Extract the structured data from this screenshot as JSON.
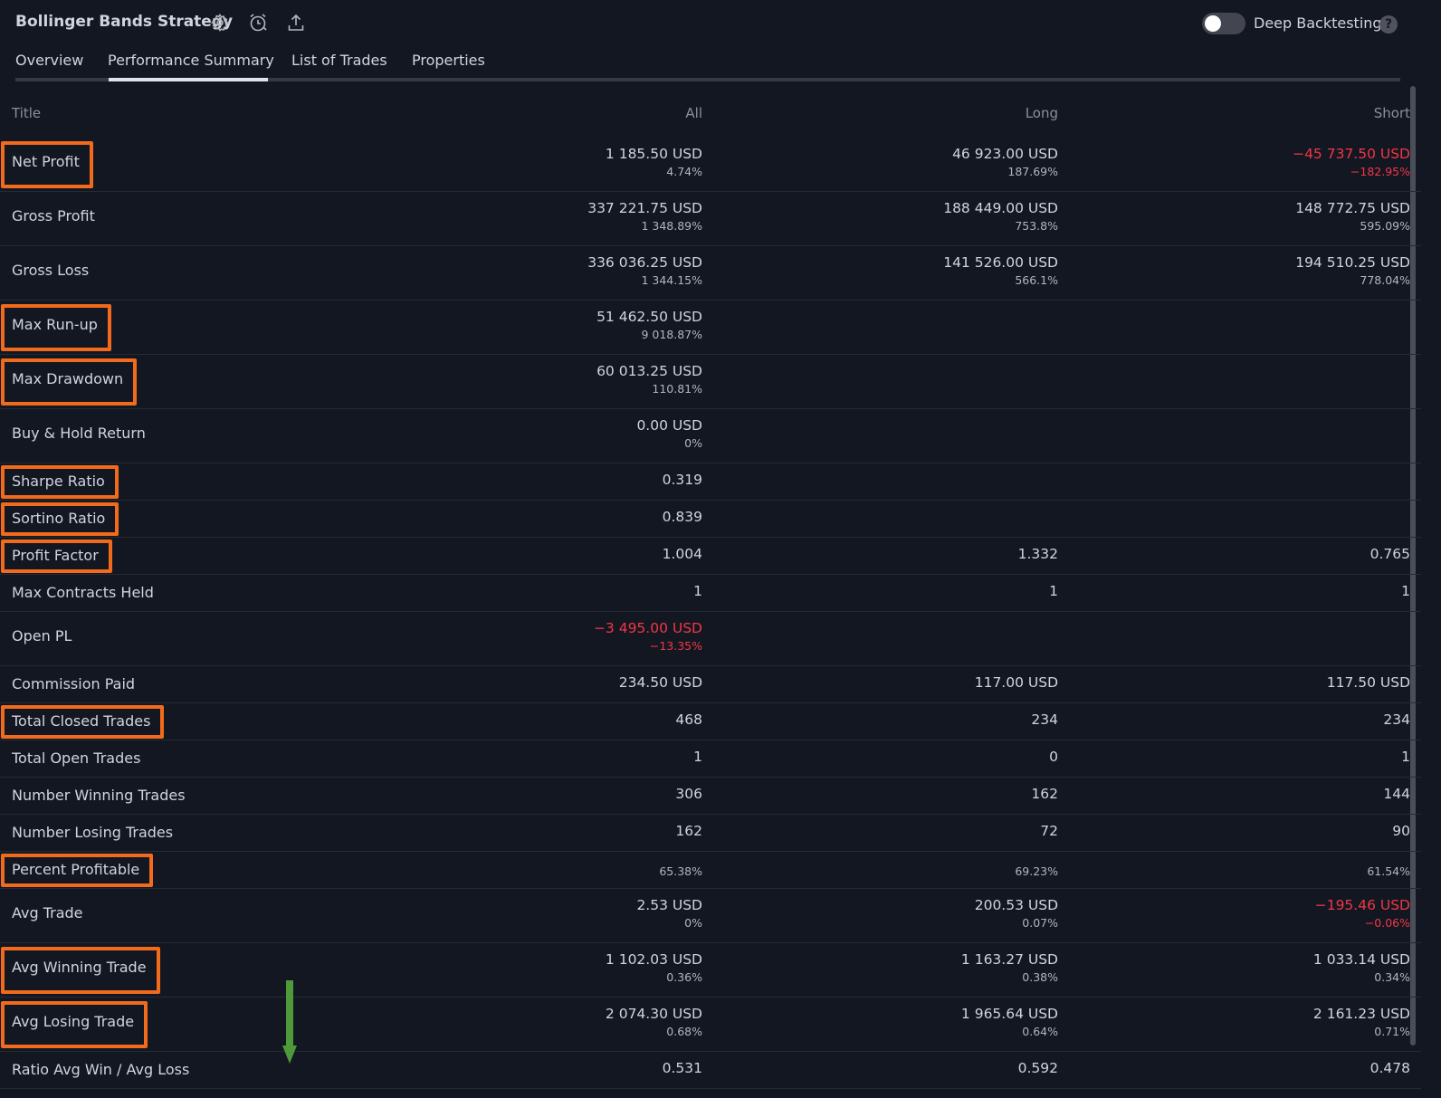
{
  "header": {
    "strategy_title": "Bollinger Bands Strategy",
    "icons": [
      "settings-icon",
      "alert-clock-icon",
      "export-icon"
    ],
    "deep_backtesting_label": "Deep Backtesting",
    "deep_backtesting_enabled": false,
    "help_glyph": "?"
  },
  "tabs": [
    {
      "label": "Overview"
    },
    {
      "label": "Performance Summary",
      "active": true
    },
    {
      "label": "List of Trades"
    },
    {
      "label": "Properties"
    }
  ],
  "table": {
    "columns": {
      "title": "Title",
      "all": "All",
      "long": "Long",
      "short": "Short"
    },
    "rows": [
      {
        "title": "Net Profit",
        "highlighted": true,
        "all": {
          "value": "1 185.50 USD",
          "pct": "4.74%"
        },
        "long": {
          "value": "46 923.00 USD",
          "pct": "187.69%"
        },
        "short": {
          "value": "−45 737.50 USD",
          "pct": "−182.95%",
          "negative": true
        }
      },
      {
        "title": "Gross Profit",
        "all": {
          "value": "337 221.75 USD",
          "pct": "1 348.89%"
        },
        "long": {
          "value": "188 449.00 USD",
          "pct": "753.8%"
        },
        "short": {
          "value": "148 772.75 USD",
          "pct": "595.09%"
        }
      },
      {
        "title": "Gross Loss",
        "all": {
          "value": "336 036.25 USD",
          "pct": "1 344.15%"
        },
        "long": {
          "value": "141 526.00 USD",
          "pct": "566.1%"
        },
        "short": {
          "value": "194 510.25 USD",
          "pct": "778.04%"
        }
      },
      {
        "title": "Max Run-up",
        "highlighted": true,
        "all": {
          "value": "51 462.50 USD",
          "pct": "9 018.87%"
        }
      },
      {
        "title": "Max Drawdown",
        "highlighted": true,
        "all": {
          "value": "60 013.25 USD",
          "pct": "110.81%"
        }
      },
      {
        "title": "Buy & Hold Return",
        "all": {
          "value": "0.00 USD",
          "pct": "0%"
        }
      },
      {
        "title": "Sharpe Ratio",
        "highlighted": true,
        "single": true,
        "all": {
          "value": "0.319"
        }
      },
      {
        "title": "Sortino Ratio",
        "highlighted": true,
        "single": true,
        "all": {
          "value": "0.839"
        }
      },
      {
        "title": "Profit Factor",
        "highlighted": true,
        "single": true,
        "all": {
          "value": "1.004"
        },
        "long": {
          "value": "1.332"
        },
        "short": {
          "value": "0.765"
        }
      },
      {
        "title": "Max Contracts Held",
        "single": true,
        "all": {
          "value": "1"
        },
        "long": {
          "value": "1"
        },
        "short": {
          "value": "1"
        }
      },
      {
        "title": "Open PL",
        "all": {
          "value": "−3 495.00 USD",
          "pct": "−13.35%",
          "negative": true
        }
      },
      {
        "title": "Commission Paid",
        "single": true,
        "all": {
          "value": "234.50 USD"
        },
        "long": {
          "value": "117.00 USD"
        },
        "short": {
          "value": "117.50 USD"
        }
      },
      {
        "title": "Total Closed Trades",
        "highlighted": true,
        "single": true,
        "all": {
          "value": "468"
        },
        "long": {
          "value": "234"
        },
        "short": {
          "value": "234"
        }
      },
      {
        "title": "Total Open Trades",
        "single": true,
        "all": {
          "value": "1"
        },
        "long": {
          "value": "0"
        },
        "short": {
          "value": "1"
        }
      },
      {
        "title": "Number Winning Trades",
        "single": true,
        "all": {
          "value": "306"
        },
        "long": {
          "value": "162"
        },
        "short": {
          "value": "144"
        }
      },
      {
        "title": "Number Losing Trades",
        "single": true,
        "all": {
          "value": "162"
        },
        "long": {
          "value": "72"
        },
        "short": {
          "value": "90"
        }
      },
      {
        "title": "Percent Profitable",
        "highlighted": true,
        "single": true,
        "pct_only": true,
        "all": {
          "pct": "65.38%"
        },
        "long": {
          "pct": "69.23%"
        },
        "short": {
          "pct": "61.54%"
        }
      },
      {
        "title": "Avg Trade",
        "all": {
          "value": "2.53 USD",
          "pct": "0%"
        },
        "long": {
          "value": "200.53 USD",
          "pct": "0.07%"
        },
        "short": {
          "value": "−195.46 USD",
          "pct": "−0.06%",
          "negative": true
        }
      },
      {
        "title": "Avg Winning Trade",
        "highlighted": true,
        "all": {
          "value": "1 102.03 USD",
          "pct": "0.36%"
        },
        "long": {
          "value": "1 163.27 USD",
          "pct": "0.38%"
        },
        "short": {
          "value": "1 033.14 USD",
          "pct": "0.34%"
        }
      },
      {
        "title": "Avg Losing Trade",
        "highlighted": true,
        "all": {
          "value": "2 074.30 USD",
          "pct": "0.68%"
        },
        "long": {
          "value": "1 965.64 USD",
          "pct": "0.64%"
        },
        "short": {
          "value": "2 161.23 USD",
          "pct": "0.71%"
        }
      },
      {
        "title": "Ratio Avg Win / Avg Loss",
        "single": true,
        "all": {
          "value": "0.531"
        },
        "long": {
          "value": "0.592"
        },
        "short": {
          "value": "0.478"
        }
      }
    ]
  },
  "colors": {
    "background": "#131722",
    "text": "#d1d4dc",
    "negative": "#f23645",
    "highlight_box": "#f26a1b",
    "arrow": "#4e9a3a"
  },
  "annotations": {
    "arrow_direction": "down"
  }
}
